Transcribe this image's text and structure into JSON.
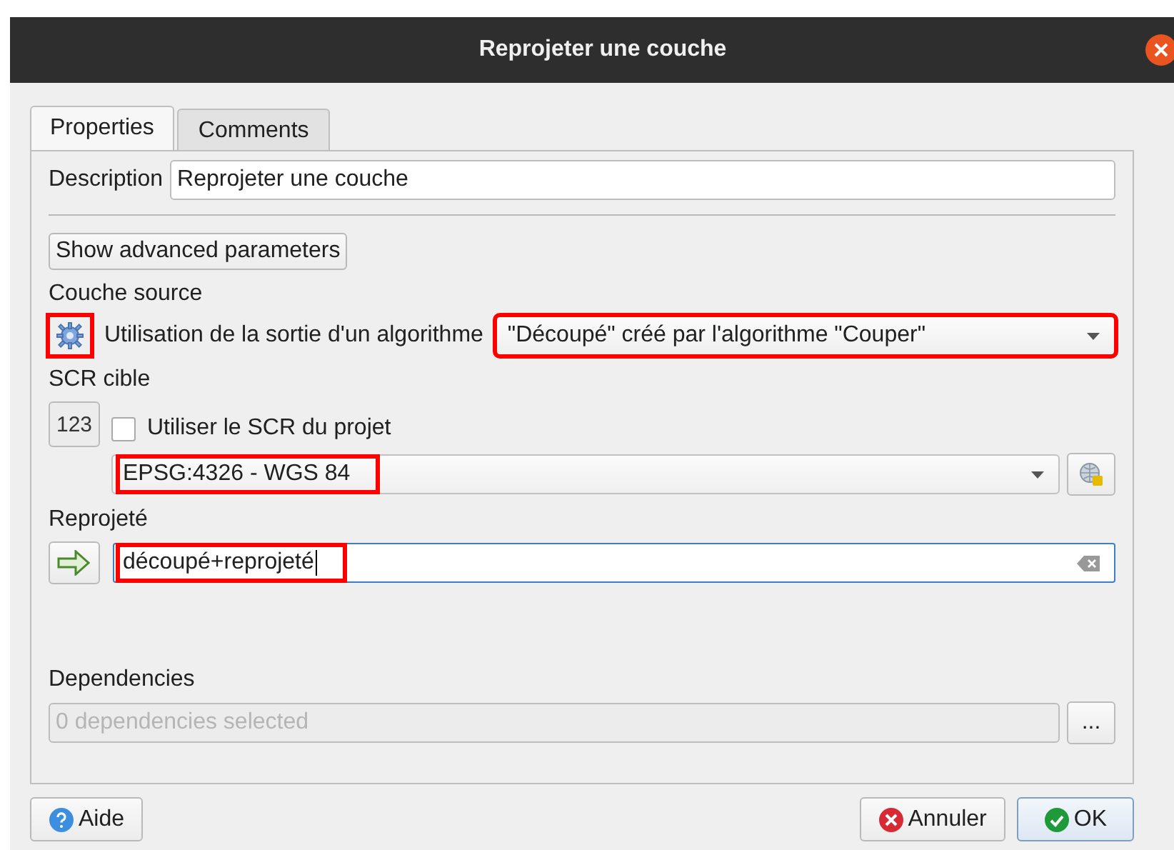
{
  "window": {
    "title": "Reprojeter une couche"
  },
  "tabs": [
    {
      "label": "Properties",
      "selected": true
    },
    {
      "label": "Comments",
      "selected": false
    }
  ],
  "description": {
    "label": "Description",
    "value": "Reprojeter une couche"
  },
  "advanced_button": "Show advanced parameters",
  "source": {
    "label": "Couche source",
    "mode": "Utilisation de la sortie d'un algorithme",
    "mode_highlighted": true,
    "value": "\"Découpé\" créé par l'algorithme \"Couper\"",
    "highlighted": true
  },
  "crs": {
    "label": "SCR cible",
    "checkbox": {
      "label": "Utiliser le SCR du projet",
      "checked": false
    },
    "icon_text": "123",
    "value": "EPSG:4326 - WGS 84",
    "highlighted": true
  },
  "output": {
    "label": "Reprojeté",
    "value": "découpé+reprojeté",
    "highlighted": true
  },
  "dependencies": {
    "label": "Dependencies",
    "placeholder": "0 dependencies selected",
    "button": "..."
  },
  "buttons": [
    {
      "label": "Aide",
      "kind": "help",
      "default": false
    },
    {
      "label": "Annuler",
      "kind": "cancel",
      "default": false
    },
    {
      "label": "OK",
      "kind": "ok",
      "default": true
    }
  ]
}
